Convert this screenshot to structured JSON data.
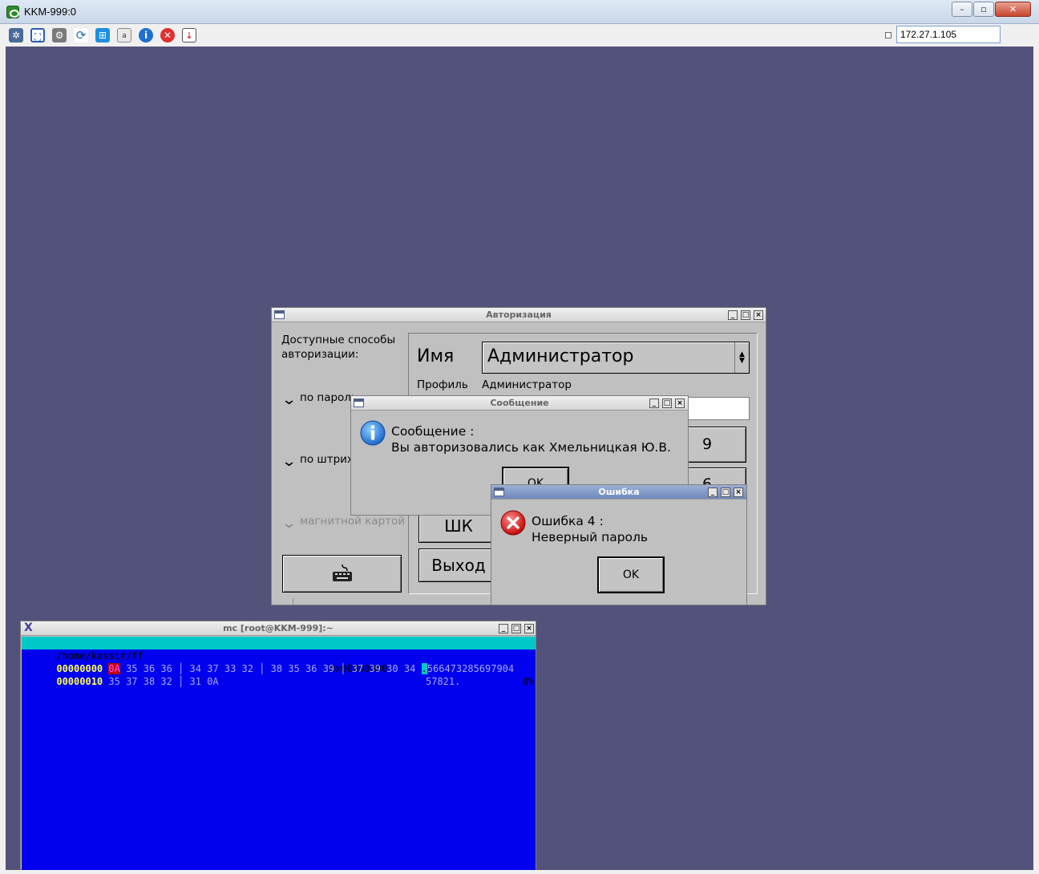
{
  "host": {
    "title": "KKM-999:0",
    "controls": {
      "minimize": "–",
      "maximize": "▫",
      "close": "✕"
    },
    "toolbar_icons": [
      "network-icon",
      "fullscreen-icon",
      "settings-icon",
      "refresh-icon",
      "windows-icon",
      "keyboard-icon",
      "info-icon",
      "disconnect-icon",
      "file-transfer-icon"
    ],
    "address": "172.27.1.105"
  },
  "auth_window": {
    "title": "Авторизация",
    "methods_label": "Доступные способы авторизации:",
    "method_password": "по пароль",
    "method_barcode": "по штрих",
    "method_magnetic": "магнитной картой",
    "name_label": "Имя",
    "name_value": "Администратор",
    "profile_label": "Профиль",
    "profile_value": "Администратор",
    "key_9": "9",
    "key_6": "6",
    "barcode_button": "ШК",
    "exit_button": "Выход"
  },
  "message_dialog": {
    "title": "Сообщение",
    "heading": "Сообщение :",
    "text": "Вы авторизовались как Хмельницкая Ю.В.",
    "ok": "OK"
  },
  "error_dialog": {
    "title": "Ошибка",
    "heading": "Ошибка 4 :",
    "text": "Неверный пароль",
    "ok": "OK"
  },
  "terminal": {
    "title": "mc [root@KKM-999]:~",
    "path": "/home/kassir/ff",
    "offset": "0x00000000",
    "percent": "0%",
    "rows": [
      {
        "addr": "00000000",
        "cursor_byte": "0A",
        "hex": " 35 36 36 │ 34 37 33 32 │ 38 35 36 39 │ 37 39 30 34 ",
        "ascii_cursor": ".",
        "ascii": "566473285697904"
      },
      {
        "addr": "00000010",
        "cursor_byte": "",
        "hex": "35 37 38 32 │ 31 0A",
        "ascii_cursor": "",
        "ascii": "57821."
      }
    ]
  }
}
